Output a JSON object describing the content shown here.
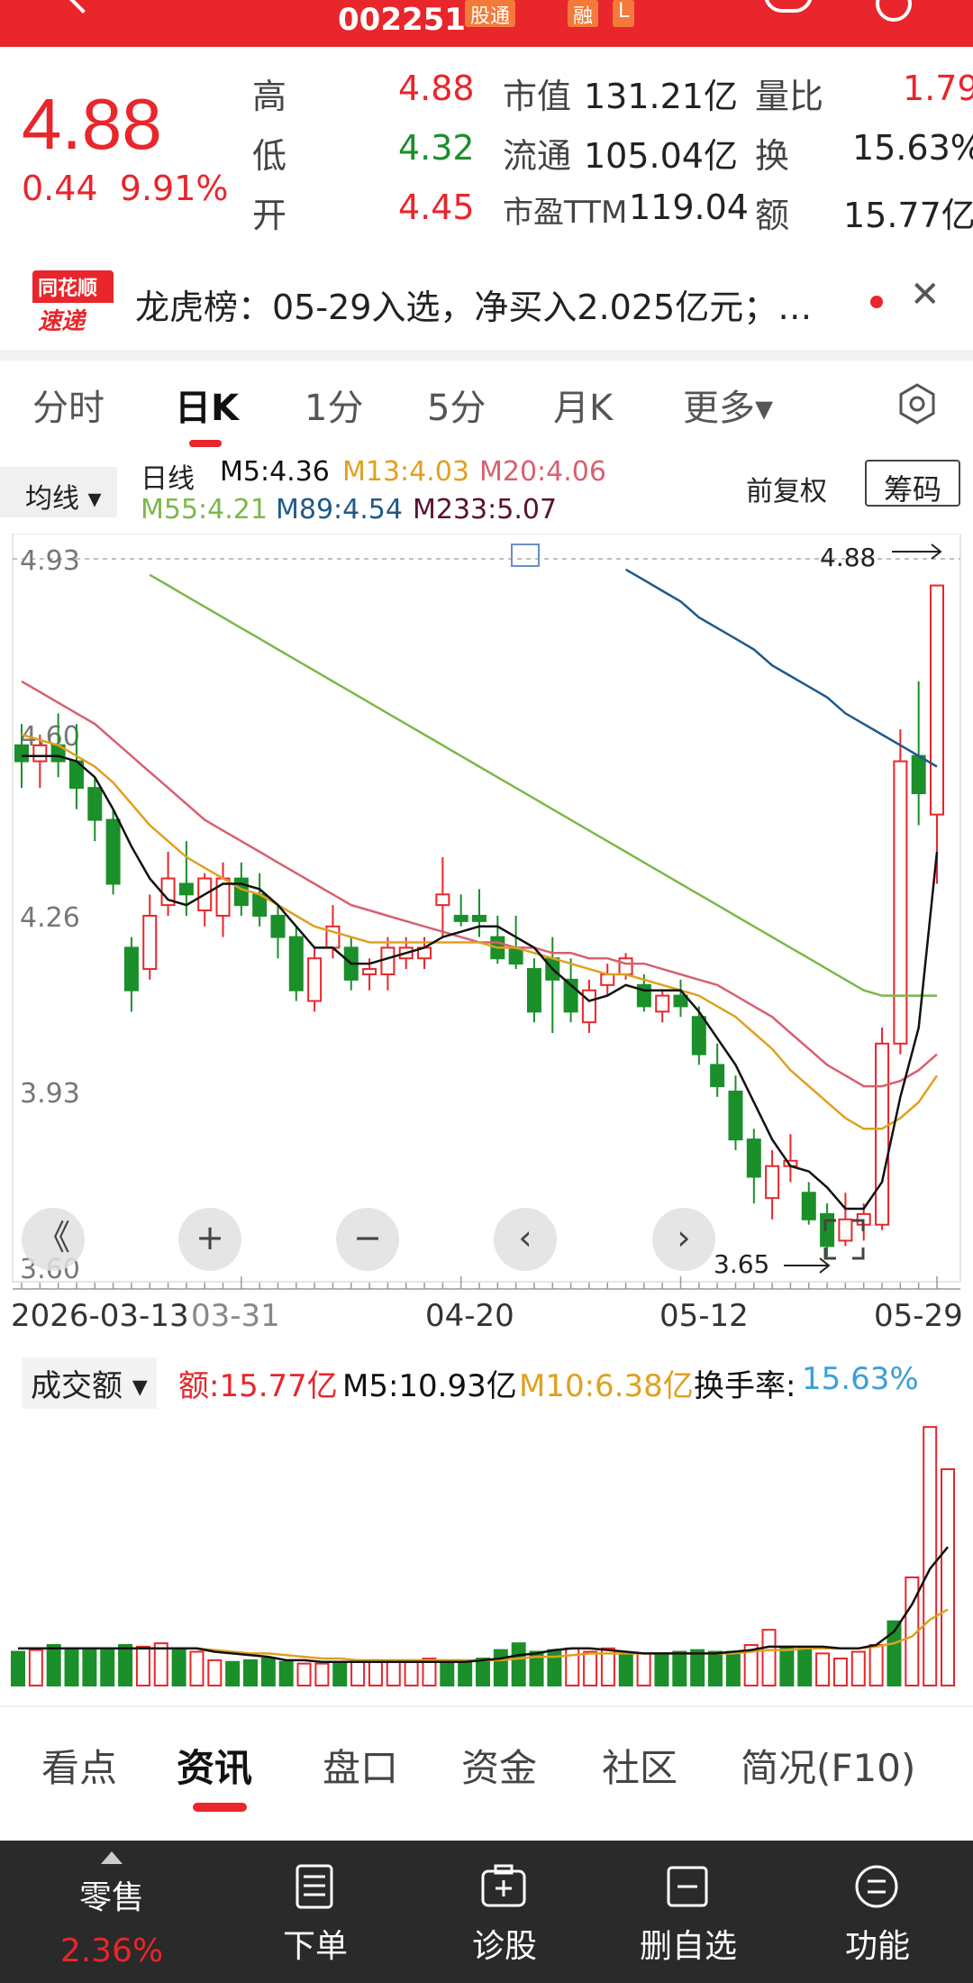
{
  "header": {
    "code": "002251",
    "tag_stock_connect": "股通",
    "tag_margin": "融",
    "tag_l": "L"
  },
  "quote": {
    "price": "4.88",
    "change": "0.44",
    "change_pct": "9.91%",
    "high_label": "高",
    "high": "4.88",
    "low_label": "低",
    "low": "4.32",
    "open_label": "开",
    "open": "4.45",
    "mcap_label": "市值",
    "mcap": "131.21亿",
    "float_label": "流通",
    "float": "105.04亿",
    "pe_label": "市盈TTM",
    "pe": "119.04",
    "vr_label": "量比",
    "vr": "1.79",
    "turn_label": "换",
    "turn": "15.63%",
    "amt_label": "额",
    "amt": "15.77亿"
  },
  "news": {
    "logo_top": "同花顺",
    "logo_bottom": "速递",
    "text": "龙虎榜：05-29入选，净买入2.025亿元；…"
  },
  "tabs": [
    "分时",
    "日K",
    "1分",
    "5分",
    "月K",
    "更多▾"
  ],
  "indicators": {
    "ma_button": "均线 ▾",
    "period": "日线",
    "m5": "M5:4.36",
    "m13": "M13:4.03",
    "m20": "M20:4.06",
    "m55": "M55:4.21",
    "m89": "M89:4.54",
    "m233": "M233:5.07",
    "adjust": "前复权",
    "chip_button": "筹码"
  },
  "chart_data": {
    "type": "candlestick",
    "y_ticks": [
      "4.93",
      "4.60",
      "4.26",
      "3.93",
      "3.60"
    ],
    "ylim": [
      3.6,
      4.93
    ],
    "high_marker": "4.88",
    "low_marker": "3.65",
    "x_ticks": [
      "2026-03-13",
      "03-31",
      "04-20",
      "05-12",
      "05-29"
    ],
    "colors": {
      "up": "#e8262b",
      "down": "#1b8f2a",
      "m5": "#111111",
      "m13": "#e0a020",
      "m20": "#d86070",
      "m55": "#7bb84a",
      "m89": "#1f5a8a"
    },
    "candles": [
      [
        4.58,
        4.62,
        4.5,
        4.55
      ],
      [
        4.55,
        4.6,
        4.5,
        4.58
      ],
      [
        4.58,
        4.64,
        4.52,
        4.55
      ],
      [
        4.55,
        4.62,
        4.46,
        4.5
      ],
      [
        4.5,
        4.52,
        4.4,
        4.44
      ],
      [
        4.44,
        4.46,
        4.3,
        4.32
      ],
      [
        4.2,
        4.22,
        4.08,
        4.12
      ],
      [
        4.16,
        4.3,
        4.14,
        4.26
      ],
      [
        4.28,
        4.38,
        4.26,
        4.33
      ],
      [
        4.32,
        4.4,
        4.26,
        4.3
      ],
      [
        4.27,
        4.34,
        4.24,
        4.33
      ],
      [
        4.26,
        4.36,
        4.22,
        4.33
      ],
      [
        4.33,
        4.36,
        4.26,
        4.28
      ],
      [
        4.3,
        4.34,
        4.24,
        4.26
      ],
      [
        4.26,
        4.28,
        4.18,
        4.22
      ],
      [
        4.22,
        4.24,
        4.1,
        4.12
      ],
      [
        4.1,
        4.2,
        4.08,
        4.18
      ],
      [
        4.2,
        4.28,
        4.18,
        4.24
      ],
      [
        4.2,
        4.22,
        4.12,
        4.14
      ],
      [
        4.15,
        4.18,
        4.12,
        4.16
      ],
      [
        4.15,
        4.22,
        4.12,
        4.2
      ],
      [
        4.18,
        4.22,
        4.16,
        4.2
      ],
      [
        4.18,
        4.22,
        4.16,
        4.2
      ],
      [
        4.28,
        4.37,
        4.22,
        4.3
      ],
      [
        4.26,
        4.3,
        4.24,
        4.25
      ],
      [
        4.26,
        4.31,
        4.22,
        4.25
      ],
      [
        4.22,
        4.26,
        4.17,
        4.18
      ],
      [
        4.2,
        4.26,
        4.16,
        4.17
      ],
      [
        4.16,
        4.18,
        4.06,
        4.08
      ],
      [
        4.18,
        4.22,
        4.04,
        4.14
      ],
      [
        4.14,
        4.18,
        4.06,
        4.08
      ],
      [
        4.06,
        4.14,
        4.04,
        4.12
      ],
      [
        4.13,
        4.17,
        4.11,
        4.15
      ],
      [
        4.15,
        4.19,
        4.14,
        4.18
      ],
      [
        4.13,
        4.15,
        4.08,
        4.09
      ],
      [
        4.08,
        4.12,
        4.06,
        4.11
      ],
      [
        4.11,
        4.14,
        4.07,
        4.09
      ],
      [
        4.07,
        4.09,
        3.98,
        4.0
      ],
      [
        3.98,
        4.02,
        3.92,
        3.94
      ],
      [
        3.93,
        3.96,
        3.82,
        3.84
      ],
      [
        3.84,
        3.86,
        3.72,
        3.77
      ],
      [
        3.73,
        3.82,
        3.69,
        3.79
      ],
      [
        3.79,
        3.85,
        3.76,
        3.8
      ],
      [
        3.74,
        3.76,
        3.68,
        3.69
      ],
      [
        3.7,
        3.72,
        3.62,
        3.64
      ],
      [
        3.65,
        3.74,
        3.64,
        3.69
      ],
      [
        3.68,
        3.72,
        3.65,
        3.7
      ],
      [
        3.68,
        4.05,
        3.67,
        4.02
      ],
      [
        4.02,
        4.61,
        4.0,
        4.55
      ],
      [
        4.56,
        4.7,
        4.43,
        4.49
      ],
      [
        4.45,
        4.88,
        4.32,
        4.88
      ]
    ],
    "ma_lines": {
      "m5": [
        4.56,
        4.56,
        4.56,
        4.55,
        4.52,
        4.46,
        4.39,
        4.33,
        4.29,
        4.28,
        4.3,
        4.32,
        4.32,
        4.31,
        4.28,
        4.24,
        4.2,
        4.2,
        4.17,
        4.17,
        4.18,
        4.19,
        4.2,
        4.22,
        4.23,
        4.24,
        4.24,
        4.22,
        4.2,
        4.16,
        4.13,
        4.1,
        4.11,
        4.13,
        4.12,
        4.12,
        4.12,
        4.08,
        4.03,
        3.98,
        3.91,
        3.84,
        3.79,
        3.78,
        3.75,
        3.71,
        3.71,
        3.76,
        3.92,
        4.05,
        4.38
      ],
      "m13": [
        4.6,
        4.59,
        4.58,
        4.56,
        4.54,
        4.51,
        4.47,
        4.43,
        4.4,
        4.37,
        4.35,
        4.33,
        4.31,
        4.3,
        4.28,
        4.26,
        4.24,
        4.23,
        4.22,
        4.21,
        4.21,
        4.21,
        4.21,
        4.21,
        4.21,
        4.21,
        4.2,
        4.2,
        4.19,
        4.18,
        4.17,
        4.16,
        4.15,
        4.15,
        4.14,
        4.13,
        4.12,
        4.11,
        4.09,
        4.07,
        4.04,
        4.01,
        3.97,
        3.94,
        3.91,
        3.88,
        3.86,
        3.86,
        3.88,
        3.91,
        3.96
      ],
      "m20": [
        4.7,
        4.68,
        4.66,
        4.64,
        4.62,
        4.59,
        4.56,
        4.53,
        4.5,
        4.47,
        4.44,
        4.42,
        4.4,
        4.38,
        4.36,
        4.34,
        4.32,
        4.3,
        4.28,
        4.27,
        4.26,
        4.25,
        4.24,
        4.23,
        4.22,
        4.21,
        4.21,
        4.2,
        4.2,
        4.19,
        4.19,
        4.18,
        4.18,
        4.17,
        4.17,
        4.16,
        4.15,
        4.14,
        4.13,
        4.11,
        4.09,
        4.07,
        4.04,
        4.01,
        3.98,
        3.96,
        3.94,
        3.94,
        3.95,
        3.97,
        4.0
      ],
      "m55": [
        null,
        null,
        null,
        null,
        null,
        null,
        null,
        4.9,
        4.88,
        4.86,
        4.84,
        4.82,
        4.8,
        4.78,
        4.76,
        4.74,
        4.72,
        4.7,
        4.68,
        4.66,
        4.64,
        4.62,
        4.6,
        4.58,
        4.56,
        4.54,
        4.52,
        4.5,
        4.48,
        4.46,
        4.44,
        4.42,
        4.4,
        4.38,
        4.36,
        4.34,
        4.32,
        4.3,
        4.28,
        4.26,
        4.24,
        4.22,
        4.2,
        4.18,
        4.16,
        4.14,
        4.12,
        4.11,
        4.11,
        4.11,
        4.11
      ],
      "m89": [
        null,
        null,
        null,
        null,
        null,
        null,
        null,
        null,
        null,
        null,
        null,
        null,
        null,
        null,
        null,
        null,
        null,
        null,
        null,
        null,
        null,
        null,
        null,
        null,
        null,
        null,
        null,
        null,
        null,
        null,
        null,
        null,
        null,
        4.91,
        4.89,
        4.87,
        4.85,
        4.82,
        4.8,
        4.78,
        4.76,
        4.73,
        4.71,
        4.69,
        4.67,
        4.64,
        4.62,
        4.6,
        4.58,
        4.56,
        4.54
      ]
    },
    "volume": {
      "header_label": "成交额 ▾",
      "amount": "额:15.77亿",
      "m5": "M5:10.93亿",
      "m10": "M10:6.38亿",
      "turnover_label": "换手率:",
      "turnover": "15.63%",
      "values": [
        2.0,
        2.1,
        2.4,
        2.2,
        2.1,
        2.2,
        2.4,
        2.3,
        2.5,
        2.1,
        2.0,
        1.5,
        1.4,
        1.5,
        1.6,
        1.4,
        1.3,
        1.3,
        1.4,
        1.4,
        1.5,
        1.4,
        1.4,
        1.6,
        1.3,
        1.4,
        1.6,
        2.1,
        2.5,
        2.0,
        2.1,
        2.2,
        2.0,
        2.2,
        1.8,
        1.9,
        1.8,
        2.0,
        2.1,
        2.0,
        2.0,
        2.4,
        3.3,
        2.2,
        2.1,
        1.9,
        1.6,
        2.0,
        2.4,
        3.8,
        6.4,
        15.3,
        12.8
      ],
      "ma5": [
        2.2,
        2.2,
        2.2,
        2.2,
        2.2,
        2.2,
        2.2,
        2.2,
        2.2,
        2.2,
        2.2,
        2.0,
        1.9,
        1.8,
        1.7,
        1.5,
        1.5,
        1.4,
        1.4,
        1.4,
        1.4,
        1.4,
        1.4,
        1.4,
        1.4,
        1.4,
        1.5,
        1.6,
        1.8,
        1.9,
        2.1,
        2.2,
        2.2,
        2.1,
        2.0,
        1.9,
        1.9,
        1.9,
        1.9,
        1.9,
        2.0,
        2.1,
        2.3,
        2.3,
        2.3,
        2.3,
        2.2,
        2.2,
        2.4,
        3.2,
        4.8,
        6.9,
        8.2
      ],
      "ma10": [
        2.2,
        2.2,
        2.2,
        2.2,
        2.2,
        2.2,
        2.2,
        2.2,
        2.2,
        2.2,
        2.2,
        2.1,
        2.0,
        1.9,
        1.9,
        1.8,
        1.7,
        1.6,
        1.6,
        1.5,
        1.5,
        1.5,
        1.5,
        1.5,
        1.5,
        1.5,
        1.5,
        1.5,
        1.6,
        1.7,
        1.7,
        1.8,
        1.9,
        1.9,
        1.9,
        1.9,
        1.9,
        1.9,
        1.9,
        1.9,
        1.9,
        2.0,
        2.1,
        2.1,
        2.2,
        2.2,
        2.2,
        2.2,
        2.3,
        2.5,
        2.9,
        3.9,
        4.5
      ]
    }
  },
  "chart_controls": [
    "《",
    "+",
    "−",
    "‹",
    "›"
  ],
  "bottom_tabs": [
    "看点",
    "资讯",
    "盘口",
    "资金",
    "社区",
    "简况(F10)"
  ],
  "bottom_bar": {
    "retail_label": "零售",
    "retail_pct": "2.36%",
    "order": "下单",
    "diagnose": "诊股",
    "remove_watch": "删自选",
    "functions": "功能"
  }
}
